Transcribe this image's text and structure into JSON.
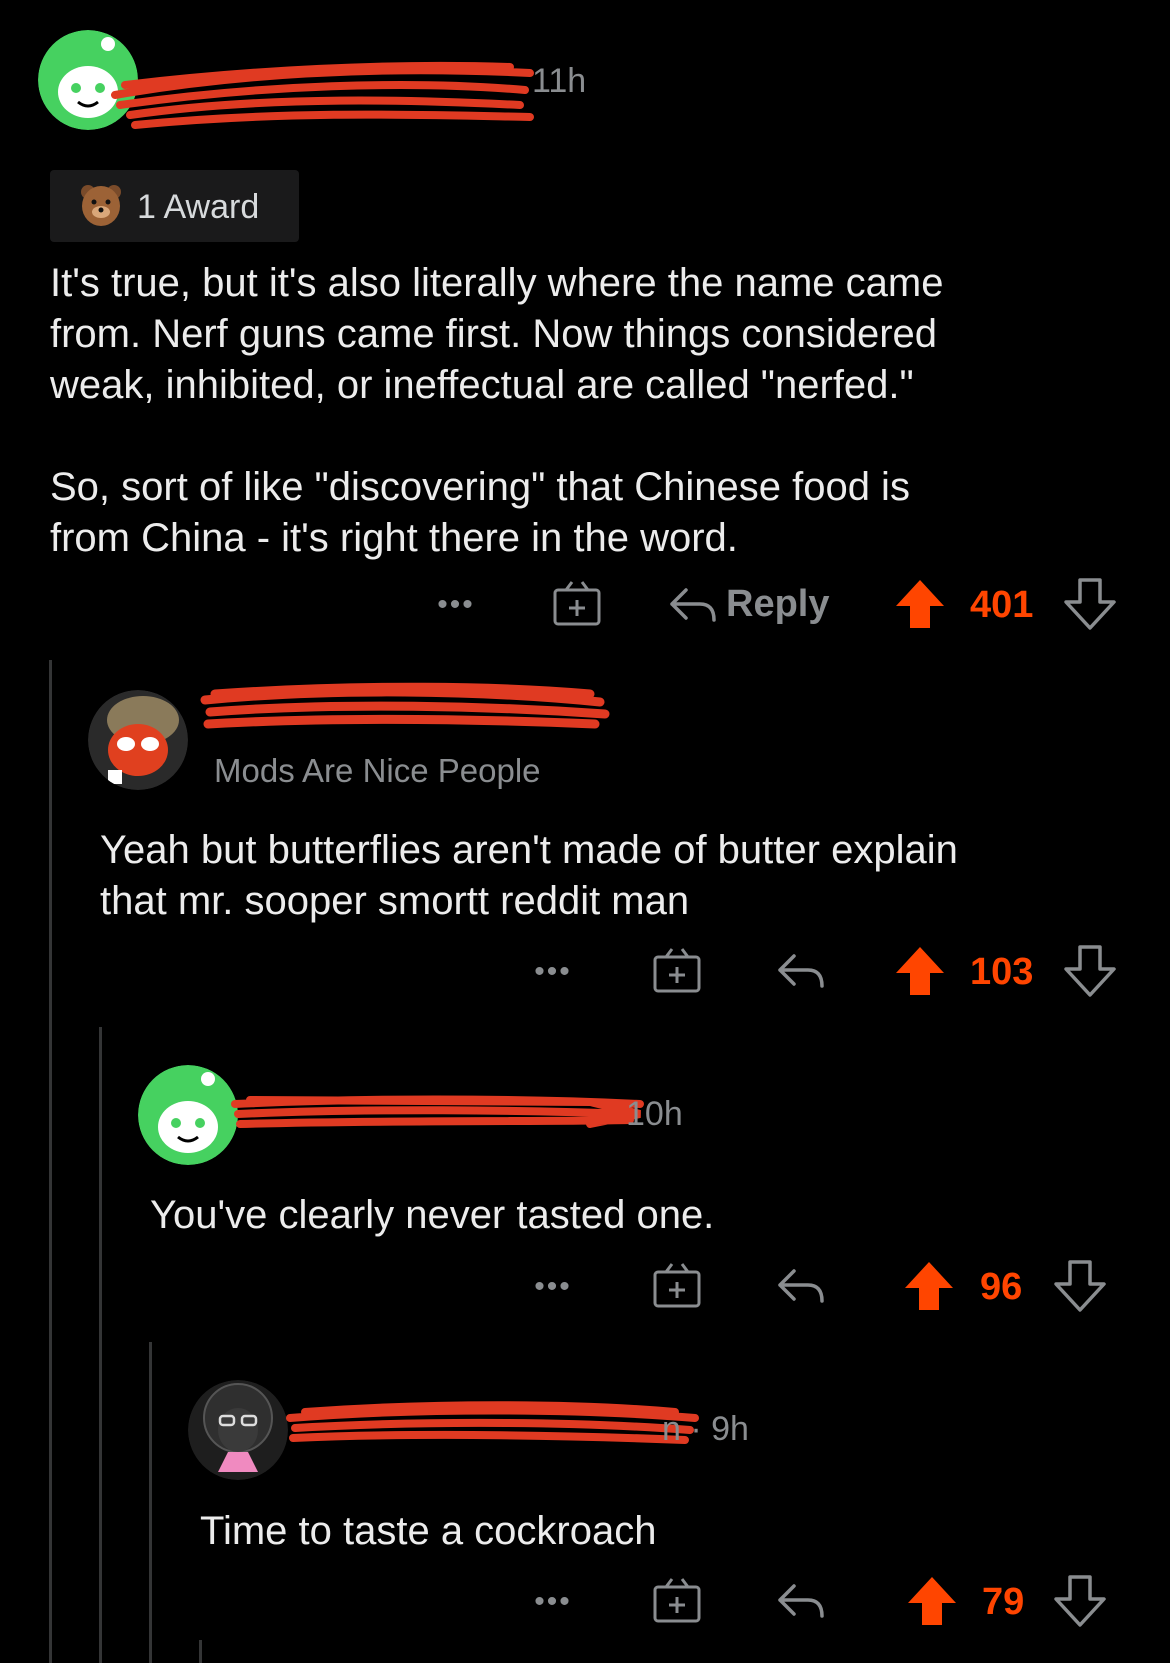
{
  "comments": [
    {
      "timestamp_fragment": "11h",
      "award": {
        "label": "1 Award",
        "icon": "bear-award-icon"
      },
      "body": "It's true, but it's also literally where the name came\nfrom.  Nerf guns came first.  Now things considered\nweak, inhibited, or ineffectual are called \"nerfed.\"\n\nSo, sort of like \"discovering\" that Chinese food is\nfrom China - it's right there in the word.",
      "actions": {
        "more": "•••",
        "award_icon": "gift-icon",
        "reply_label": "Reply",
        "score": "401"
      }
    },
    {
      "flair": "Mods Are Nice People",
      "body": "Yeah but butterflies aren't made of butter explain\nthat mr. sooper smortt reddit man",
      "actions": {
        "more": "•••",
        "award_icon": "gift-icon",
        "score": "103"
      }
    },
    {
      "timestamp_fragment": "10h",
      "body": "You've clearly never tasted one.",
      "actions": {
        "more": "•••",
        "award_icon": "gift-icon",
        "score": "96"
      }
    },
    {
      "timestamp_fragment": "n · 9h",
      "body": "Time to taste a cockroach",
      "actions": {
        "more": "•••",
        "award_icon": "gift-icon",
        "score": "79"
      }
    }
  ],
  "colors": {
    "upvote": "#ff4500",
    "muted": "#8a8d90",
    "redaction": "#e03a22",
    "thread_line": "#343536"
  }
}
